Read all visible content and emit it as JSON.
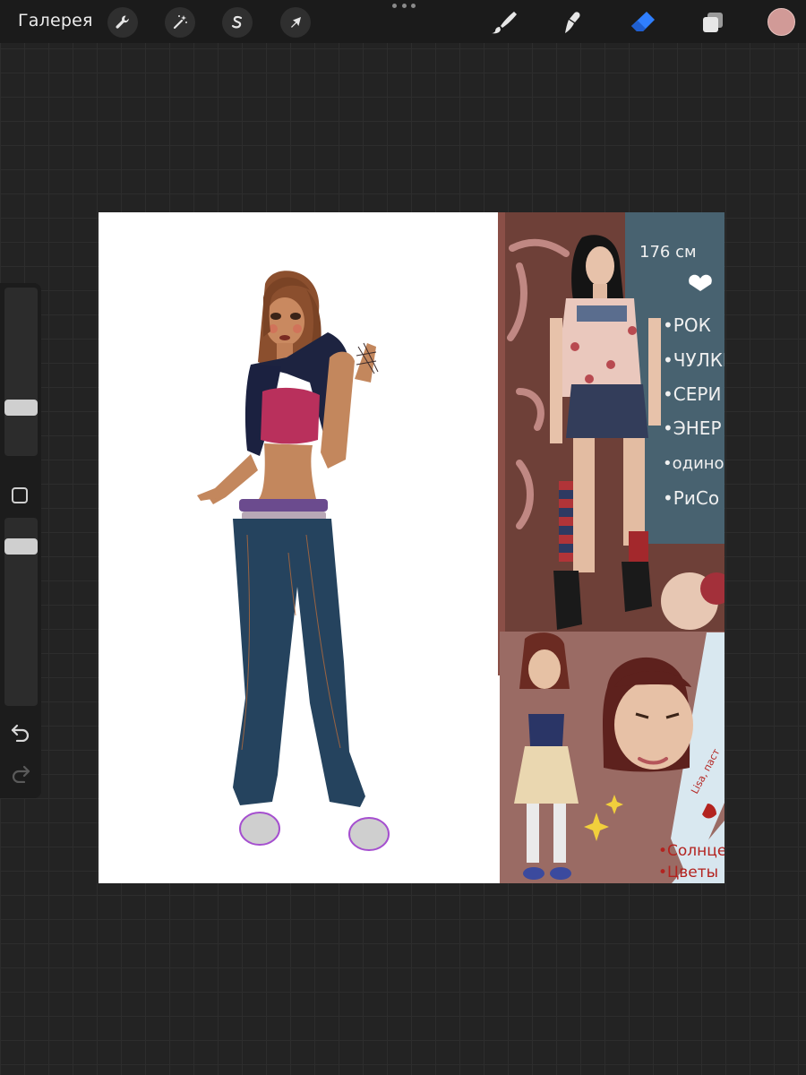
{
  "topbar": {
    "gallery_label": "Галерея",
    "left_tools": [
      {
        "name": "actions-wrench-icon"
      },
      {
        "name": "adjustments-magic-wand-icon"
      },
      {
        "name": "selection-s-icon"
      },
      {
        "name": "transform-arrow-icon"
      }
    ],
    "right_tools": [
      {
        "name": "brush-icon"
      },
      {
        "name": "smudge-icon"
      },
      {
        "name": "eraser-icon",
        "active": true
      },
      {
        "name": "layers-icon"
      }
    ],
    "current_color": "#d19a97",
    "accent_color": "#2f7fff"
  },
  "sidebar": {
    "brush_size_slider": "size",
    "opacity_slider": "opacity",
    "modify_button": "modify",
    "undo": "undo",
    "redo": "redo"
  },
  "artwork": {
    "ref1_text": [
      "176 см",
      "•РОК",
      "•ЧУЛКИ",
      "•СЕРИ",
      "•ЭНЕР",
      "•одино",
      "•РиСо"
    ],
    "ref2_text": [
      "Lisa, паст",
      "•Солнце",
      "•Цветы"
    ]
  }
}
